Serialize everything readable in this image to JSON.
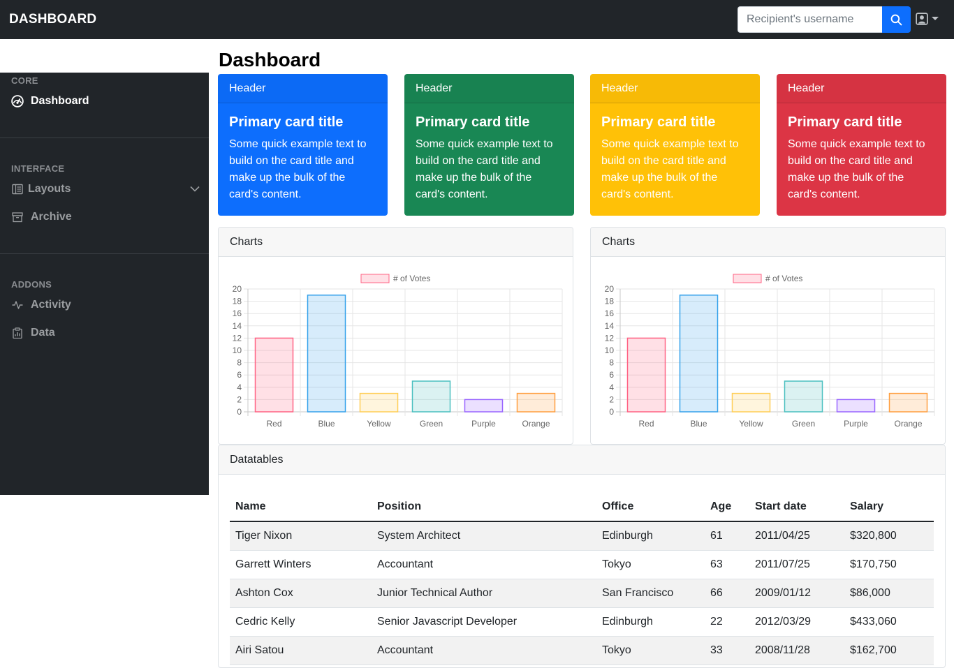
{
  "navbar": {
    "brand": "DASHBOARD",
    "search_placeholder": "Recipient's username",
    "search_value": "",
    "search_icon": "search-icon",
    "user_icon": "user-icon"
  },
  "page_title": "Dashboard",
  "sidebar": {
    "sections": [
      {
        "heading": "CORE",
        "items": [
          {
            "label": "Dashboard",
            "icon": "dashboard-icon",
            "active": true
          }
        ]
      },
      {
        "heading": "INTERFACE",
        "items": [
          {
            "label": "Layouts",
            "icon": "columns-icon",
            "has_chevron": true
          },
          {
            "label": "Archive",
            "icon": "archive-icon"
          }
        ]
      },
      {
        "heading": "ADDONS",
        "items": [
          {
            "label": "Activity",
            "icon": "activity-icon"
          },
          {
            "label": "Data",
            "icon": "clipboard-data-icon"
          }
        ]
      }
    ]
  },
  "cards": [
    {
      "header": "Header",
      "title": "Primary card title",
      "text": "Some quick example text to build on the card title and make up the bulk of the card's content.",
      "color": "#0d6efd"
    },
    {
      "header": "Header",
      "title": "Primary card title",
      "text": "Some quick example text to build on the card title and make up the bulk of the card's content.",
      "color": "#198754"
    },
    {
      "header": "Header",
      "title": "Primary card title",
      "text": "Some quick example text to build on the card title and make up the bulk of the card's content.",
      "color": "#ffc107"
    },
    {
      "header": "Header",
      "title": "Primary card title",
      "text": "Some quick example text to build on the card title and make up the bulk of the card's content.",
      "color": "#dc3545"
    }
  ],
  "chart_panels": [
    {
      "header": "Charts"
    },
    {
      "header": "Charts"
    }
  ],
  "chart_data": [
    {
      "type": "bar",
      "categories": [
        "Red",
        "Blue",
        "Yellow",
        "Green",
        "Purple",
        "Orange"
      ],
      "series": [
        {
          "name": "# of Votes",
          "values": [
            12,
            19,
            3,
            5,
            2,
            3
          ]
        }
      ],
      "ylim": [
        0,
        20
      ],
      "yticks": [
        0,
        2,
        4,
        6,
        8,
        10,
        12,
        14,
        16,
        18,
        20
      ],
      "grid": true,
      "legend": "top-center",
      "bar_fills": [
        "rgba(255,99,132,0.2)",
        "rgba(54,162,235,0.2)",
        "rgba(255,206,86,0.2)",
        "rgba(75,192,192,0.2)",
        "rgba(153,102,255,0.2)",
        "rgba(255,159,64,0.2)"
      ],
      "bar_strokes": [
        "#ff6384",
        "#36a2eb",
        "#ffce56",
        "#4bc0c0",
        "#9966ff",
        "#ff9f40"
      ]
    },
    {
      "type": "bar",
      "categories": [
        "Red",
        "Blue",
        "Yellow",
        "Green",
        "Purple",
        "Orange"
      ],
      "series": [
        {
          "name": "# of Votes",
          "values": [
            12,
            19,
            3,
            5,
            2,
            3
          ]
        }
      ],
      "ylim": [
        0,
        20
      ],
      "yticks": [
        0,
        2,
        4,
        6,
        8,
        10,
        12,
        14,
        16,
        18,
        20
      ],
      "grid": true,
      "legend": "top-center",
      "bar_fills": [
        "rgba(255,99,132,0.2)",
        "rgba(54,162,235,0.2)",
        "rgba(255,206,86,0.2)",
        "rgba(75,192,192,0.2)",
        "rgba(153,102,255,0.2)",
        "rgba(255,159,64,0.2)"
      ],
      "bar_strokes": [
        "#ff6384",
        "#36a2eb",
        "#ffce56",
        "#4bc0c0",
        "#9966ff",
        "#ff9f40"
      ]
    }
  ],
  "datatable": {
    "header": "Datatables",
    "columns": [
      "Name",
      "Position",
      "Office",
      "Age",
      "Start date",
      "Salary"
    ],
    "rows": [
      [
        "Tiger Nixon",
        "System Architect",
        "Edinburgh",
        "61",
        "2011/04/25",
        "$320,800"
      ],
      [
        "Garrett Winters",
        "Accountant",
        "Tokyo",
        "63",
        "2011/07/25",
        "$170,750"
      ],
      [
        "Ashton Cox",
        "Junior Technical Author",
        "San Francisco",
        "66",
        "2009/01/12",
        "$86,000"
      ],
      [
        "Cedric Kelly",
        "Senior Javascript Developer",
        "Edinburgh",
        "22",
        "2012/03/29",
        "$433,060"
      ],
      [
        "Airi Satou",
        "Accountant",
        "Tokyo",
        "33",
        "2008/11/28",
        "$162,700"
      ]
    ]
  }
}
